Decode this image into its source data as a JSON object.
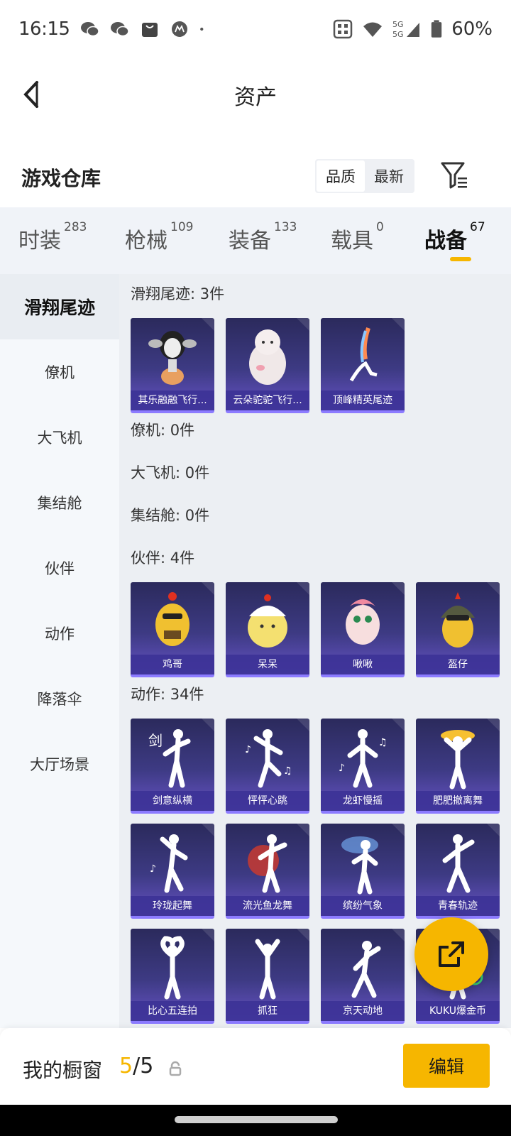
{
  "status_bar": {
    "time": "16:15",
    "battery": "60%",
    "icons": [
      "wechat-icon",
      "wechat-icon",
      "bag-icon",
      "motorola-icon",
      "dot-icon",
      "nfc-icon",
      "wifi-icon",
      "signal-5g-icon",
      "battery-icon"
    ]
  },
  "header": {
    "title": "资产"
  },
  "warehouse": {
    "title": "游戏仓库",
    "sort_options": [
      "品质",
      "最新"
    ],
    "active_sort": "品质"
  },
  "tabs": [
    {
      "label": "时装",
      "count": "283"
    },
    {
      "label": "枪械",
      "count": "109"
    },
    {
      "label": "装备",
      "count": "133"
    },
    {
      "label": "载具",
      "count": "0"
    },
    {
      "label": "战备",
      "count": "67"
    }
  ],
  "active_tab": "战备",
  "accent_color": "#f6b600",
  "side_menu": [
    "滑翔尾迹",
    "僚机",
    "大飞机",
    "集结舱",
    "伙伴",
    "动作",
    "降落伞",
    "大厅场景"
  ],
  "active_side": "滑翔尾迹",
  "sections": {
    "glide": {
      "title": "滑翔尾迹: 3件",
      "items": [
        "其乐融融飞行...",
        "云朵驼驼飞行...",
        "顶峰精英尾迹"
      ]
    },
    "wingman": {
      "title": "僚机: 0件"
    },
    "plane": {
      "title": "大飞机: 0件"
    },
    "pod": {
      "title": "集结舱: 0件"
    },
    "partner": {
      "title": "伙伴: 4件",
      "items": [
        "鸡哥",
        "呆呆",
        "啾啾",
        "盔仔"
      ]
    },
    "emote": {
      "title": "动作: 34件",
      "items": [
        "剑意纵横",
        "怦怦心跳",
        "龙虾慢摇",
        "肥肥撤离舞",
        "玲珑起舞",
        "流光鱼龙舞",
        "缤纷气象",
        "青春轨迹",
        "比心五连拍",
        "抓狂",
        "京天动地",
        "KUKU爆金币"
      ]
    }
  },
  "bottom_bar": {
    "label": "我的橱窗",
    "count_current": "5",
    "count_total": "/5",
    "edit_label": "编辑"
  }
}
